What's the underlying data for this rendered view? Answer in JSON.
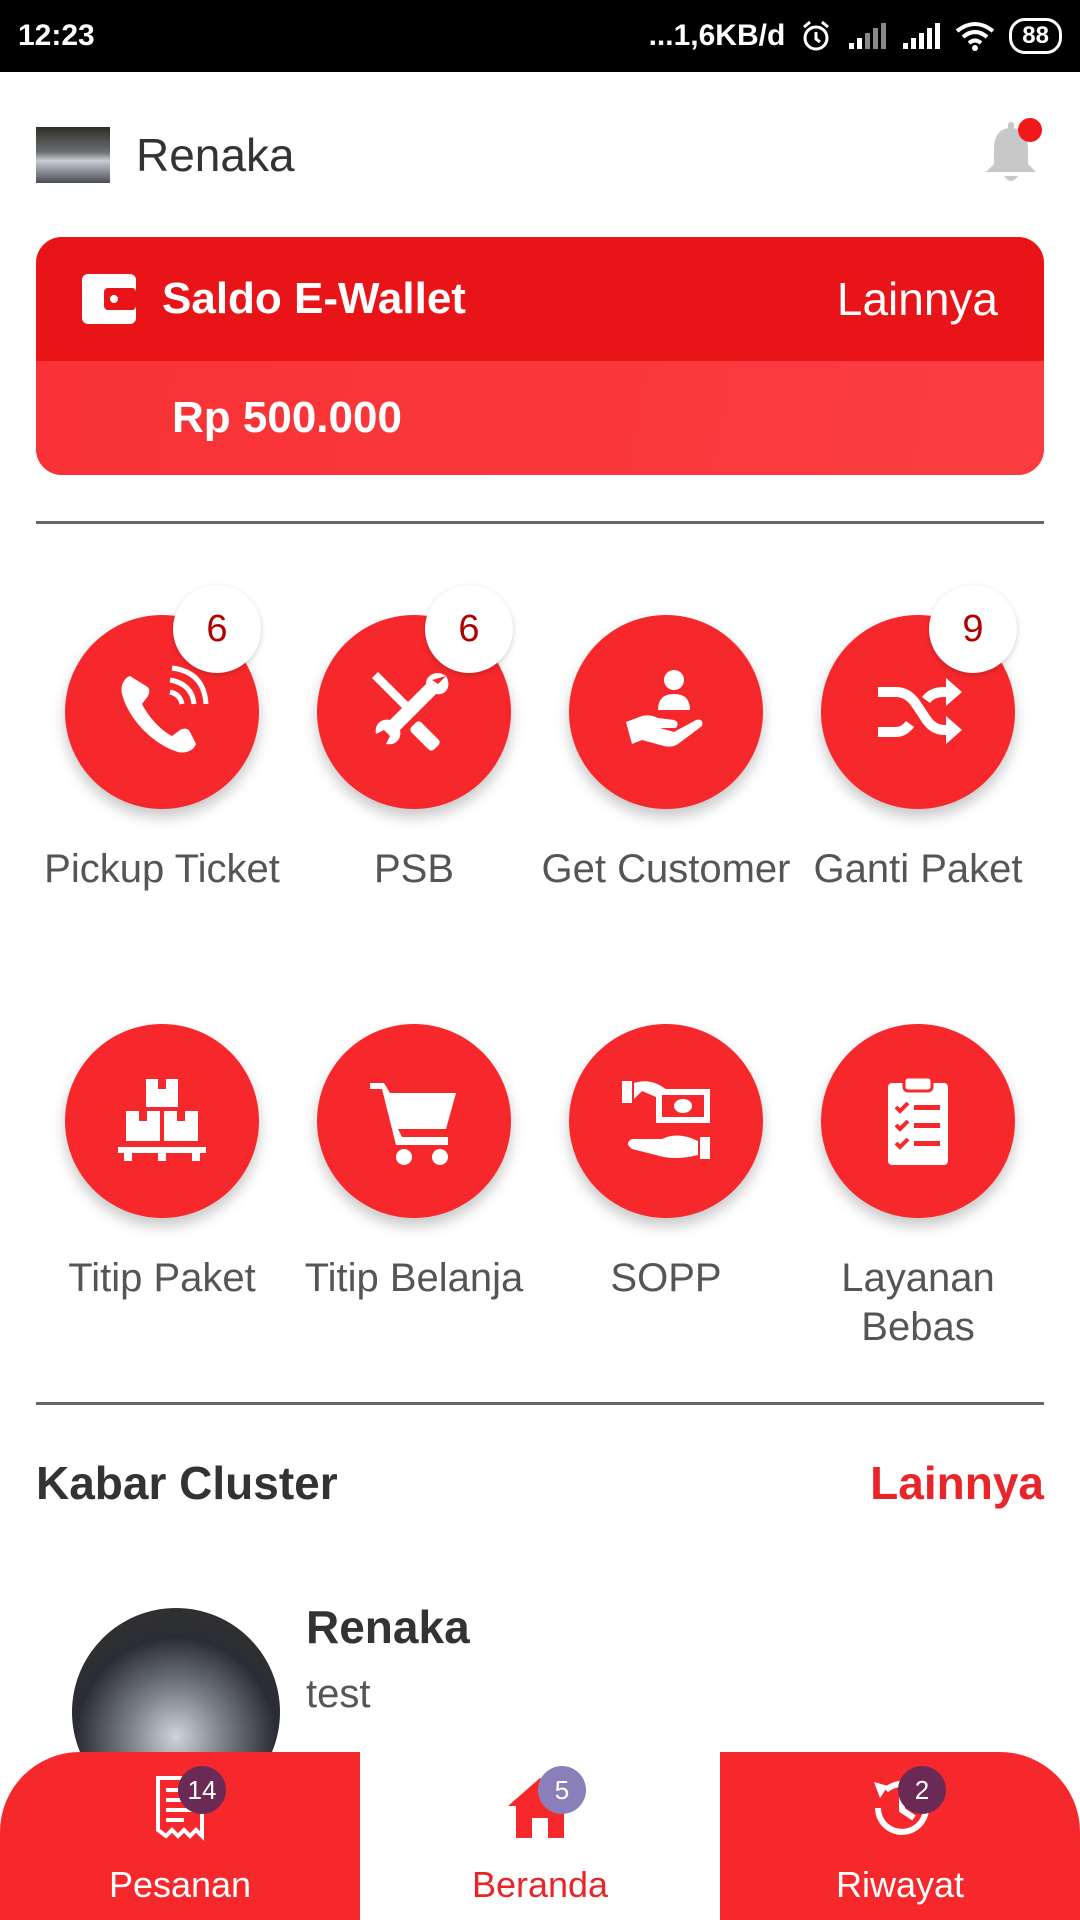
{
  "status_bar": {
    "time": "12:23",
    "net_speed": "...1,6KB/d",
    "battery": "88"
  },
  "header": {
    "title": "Renaka"
  },
  "wallet": {
    "title": "Saldo E-Wallet",
    "more_label": "Lainnya",
    "balance": "Rp 500.000"
  },
  "menu": [
    {
      "label": "Pickup Ticket",
      "icon": "phone-icon",
      "badge": "6"
    },
    {
      "label": "PSB",
      "icon": "tools-icon",
      "badge": "6"
    },
    {
      "label": "Get Customer",
      "icon": "hand-user-icon",
      "badge": ""
    },
    {
      "label": "Ganti Paket",
      "icon": "shuffle-icon",
      "badge": "9"
    },
    {
      "label": "Titip Paket",
      "icon": "boxes-icon",
      "badge": ""
    },
    {
      "label": "Titip Belanja",
      "icon": "cart-icon",
      "badge": ""
    },
    {
      "label": "SOPP",
      "icon": "money-hand-icon",
      "badge": ""
    },
    {
      "label": "Layanan Bebas",
      "icon": "clipboard-icon",
      "badge": ""
    }
  ],
  "news": {
    "title": "Kabar Cluster",
    "more_label": "Lainnya",
    "item": {
      "name": "Renaka",
      "text": "test"
    }
  },
  "bottom_nav": [
    {
      "label": "Pesanan",
      "badge": "14",
      "icon": "receipt-icon"
    },
    {
      "label": "Beranda",
      "badge": "5",
      "icon": "home-icon",
      "active": true
    },
    {
      "label": "Riwayat",
      "badge": "2",
      "icon": "history-icon"
    }
  ],
  "colors": {
    "primary": "#f7282c",
    "primary_dark": "#e81418",
    "accent_text": "#e8262a",
    "badge_text": "#b00000"
  }
}
